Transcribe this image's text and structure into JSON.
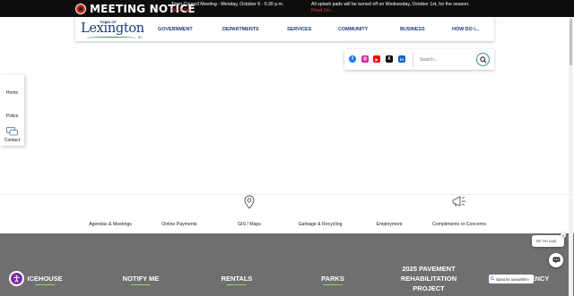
{
  "notice": {
    "title": "MEETING NOTICE",
    "items": [
      {
        "text": "Town Council Meeting - Monday, October 6 - 6:30 p.m.",
        "read_on": "Read On..."
      },
      {
        "text": "All splash pads will be turned off on Wednesday, October 1st, for the season.",
        "read_on": "Read On..."
      }
    ]
  },
  "logo": {
    "town": "TOWN OF",
    "name": "Lexington",
    "state": "SC"
  },
  "nav": [
    "GOVERNMENT",
    "DEPARTMENTS",
    "SERVICES",
    "COMMUNITY",
    "BUSINESS",
    "HOW DO I..."
  ],
  "social": [
    {
      "icon": "facebook-icon",
      "letter": "f",
      "color": "#1877f2"
    },
    {
      "icon": "instagram-icon",
      "letter": "◎",
      "color": "#d6249f"
    },
    {
      "icon": "youtube-icon",
      "letter": "▶",
      "color": "#ff0000"
    },
    {
      "icon": "x-icon",
      "letter": "X",
      "color": "#000000"
    },
    {
      "icon": "linkedin-icon",
      "letter": "in",
      "color": "#0a66c2"
    }
  ],
  "search": {
    "placeholder": "Search..."
  },
  "quick_links": [
    "Home",
    "Police",
    "Contact"
  ],
  "icon_row": [
    "Agendas & Meetings",
    "Online Payments",
    "GIS / Maps",
    "Garbage & Recycling",
    "Employment",
    "Compliments or Concerns"
  ],
  "band_links": [
    "ICEHOUSE",
    "NOTIFY ME",
    "RENTALS",
    "PARKS",
    "2025 PAVEMENT REHABILITATION PROJECT",
    "ENCY"
  ],
  "chat": {
    "greeting": "Hi! I'm Lexi."
  },
  "translate": {
    "label": "Sprache auswählen"
  },
  "colors": {
    "notice_bg": "#0d0d0d",
    "brand_blue": "#1b3a7a",
    "read_on": "#e53a2f",
    "band_bg": "#6f6f6f",
    "accent_green": "#8cd46b"
  }
}
